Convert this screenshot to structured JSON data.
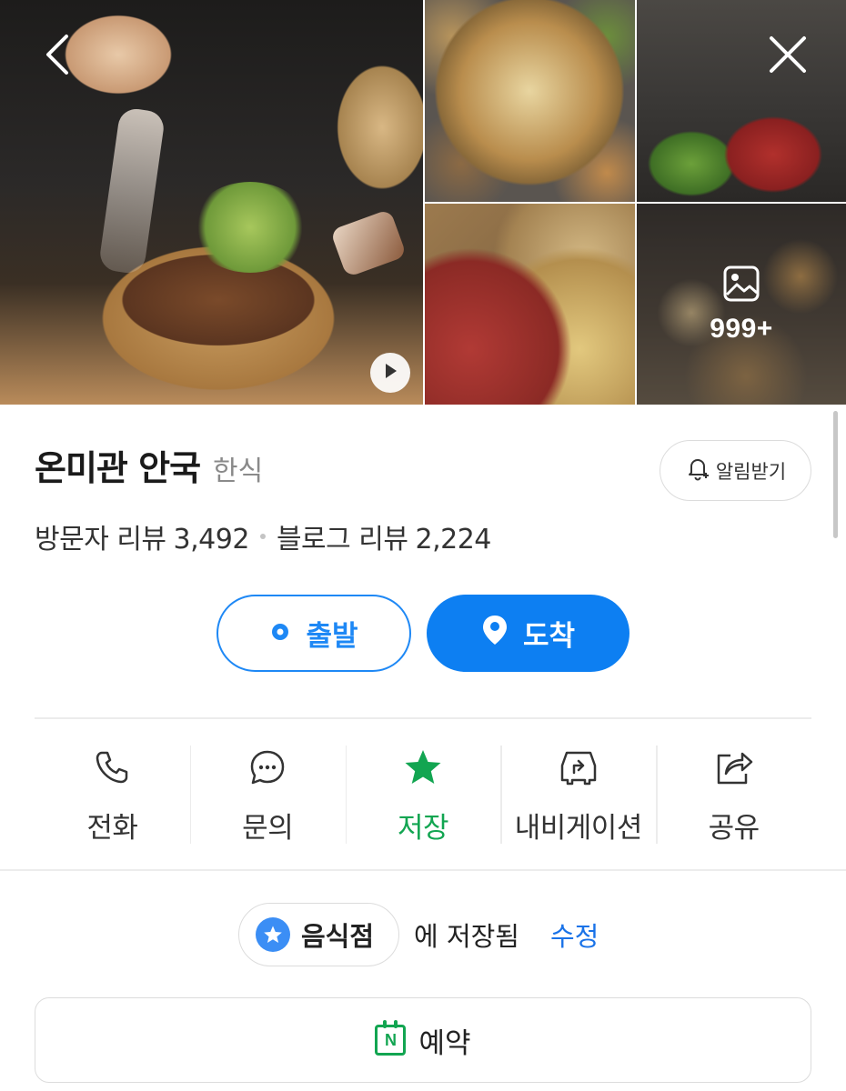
{
  "gallery": {
    "more_count": "999+"
  },
  "place": {
    "name": "온미관 안국",
    "category": "한식",
    "alarm_label": "알림받기",
    "visitor_review_label": "방문자 리뷰",
    "visitor_review_count": "3,492",
    "blog_review_label": "블로그 리뷰",
    "blog_review_count": "2,224"
  },
  "route": {
    "depart_label": "출발",
    "arrive_label": "도착"
  },
  "actions": {
    "call": "전화",
    "inquiry": "문의",
    "save": "저장",
    "navigation": "내비게이션",
    "share": "공유"
  },
  "saved": {
    "folder_name": "음식점",
    "status_text": "에 저장됨",
    "edit_label": "수정"
  },
  "reserve": {
    "label": "예약"
  },
  "colors": {
    "accent_blue": "#0d7ff2",
    "saved_green": "#12a551",
    "link_blue": "#1a73e8"
  },
  "icons": [
    "back-arrow-icon",
    "close-icon",
    "play-icon",
    "image-icon",
    "bell-icon",
    "location-dot-icon",
    "map-pin-icon",
    "phone-icon",
    "chat-bubble-icon",
    "star-icon",
    "car-navigation-icon",
    "share-icon",
    "star-circle-icon",
    "naver-calendar-icon"
  ]
}
